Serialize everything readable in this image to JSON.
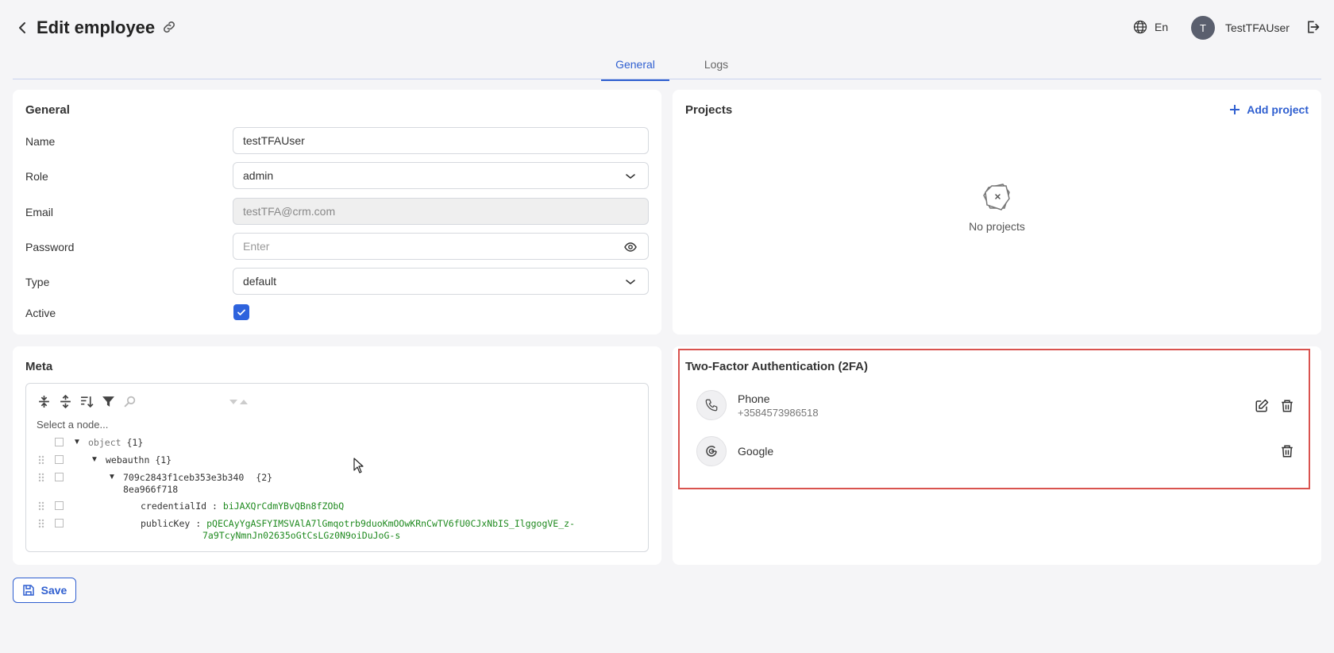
{
  "header": {
    "title": "Edit employee",
    "language": "En",
    "avatar_initial": "T",
    "username": "TestTFAUser"
  },
  "tabs": [
    {
      "label": "General",
      "active": true
    },
    {
      "label": "Logs",
      "active": false
    }
  ],
  "general": {
    "title": "General",
    "name_label": "Name",
    "name_value": "testTFAUser",
    "role_label": "Role",
    "role_value": "admin",
    "email_label": "Email",
    "email_value": "testTFA@crm.com",
    "password_label": "Password",
    "password_placeholder": "Enter",
    "type_label": "Type",
    "type_value": "default",
    "active_label": "Active",
    "active_checked": true
  },
  "projects": {
    "title": "Projects",
    "add_label": "Add project",
    "empty_text": "No projects"
  },
  "meta": {
    "title": "Meta",
    "select_node": "Select a node...",
    "tree": {
      "root_key": "object",
      "root_count": "{1}",
      "webauthn_key": "webauthn",
      "webauthn_count": "{1}",
      "id_key_line1": "709c2843f1ceb353e3b340",
      "id_key_line2": "8ea966f718",
      "id_count": "{2}",
      "credential_key": "credentialId",
      "credential_value": "biJAXQrCdmYBvQBn8fZObQ",
      "publickey_key": "publicKey",
      "publickey_value_line1": "pQECAyYgASFYIMSVAlA7lGmqotrb9duoKmOOwKRnCwTV6fU0CJxNbIS_IlggogVE_z-",
      "publickey_value_line2": "7a9TcyNmnJn02635oGtCsLGz0N9oiDuJoG-s"
    }
  },
  "tfa": {
    "title": "Two-Factor Authentication (2FA)",
    "methods": [
      {
        "name": "Phone",
        "detail": "+3584573986518"
      },
      {
        "name": "Google",
        "detail": ""
      }
    ]
  },
  "footer": {
    "save_label": "Save"
  },
  "colors": {
    "accent": "#2f5fd0",
    "highlight_border": "#d9534f",
    "json_value": "#1f8a1f"
  }
}
